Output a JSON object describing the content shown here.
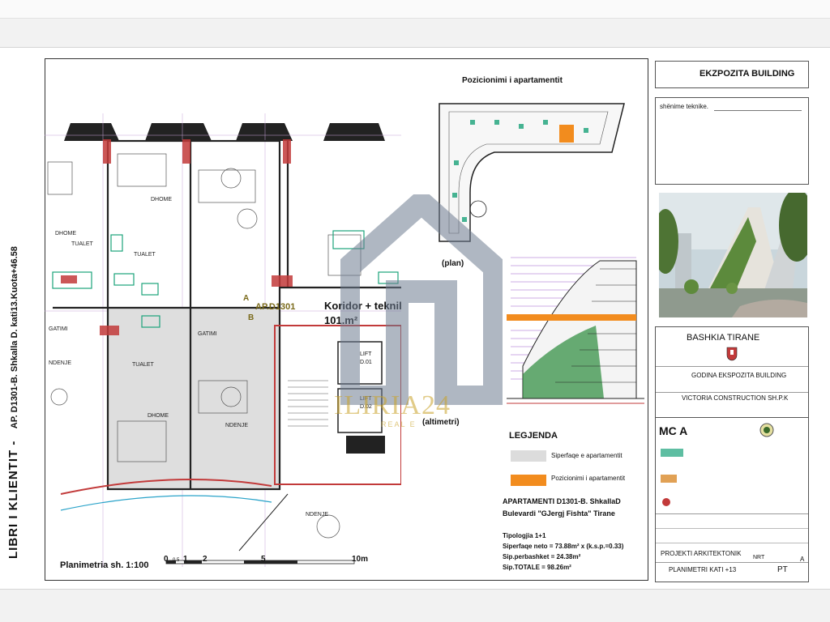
{
  "side_title": {
    "main": "LIBRI I KLIENTIT -",
    "sub": "AP. D1301-B. Shkalla D. kati13.Kuota+46.58"
  },
  "plan": {
    "apartment_label": "AP.D1301",
    "marker_a": "A",
    "marker_b": "B",
    "corridor_label": "Koridor + teknil",
    "corridor_area": "101.m²",
    "lift_1": "LIFT\nD.01",
    "lift_2": "LIFT\nD.02",
    "rooms": [
      "DHOME",
      "DHOME",
      "TUALET",
      "TUALET",
      "GATIMI",
      "GATIMI",
      "TUALET",
      "NDENJE",
      "DHOME",
      "NDENJE",
      "NDENJE"
    ],
    "scale_label": "Planimetria sh. 1:100",
    "scale_ticks": [
      "0",
      "0.5",
      "1",
      "2",
      "5",
      "10m"
    ]
  },
  "position": {
    "title": "Pozicionimi i apartamentit",
    "plan_caption": "(plan)",
    "elev_caption": "(altimetri)"
  },
  "legend": {
    "title": "LEGJENDA",
    "items": [
      {
        "label": "Siperfaqe e apartamentit",
        "color": "#dcdcdc"
      },
      {
        "label": "Pozicionimi i apartamentit",
        "color": "#f28c1e"
      }
    ]
  },
  "info": {
    "line1": "APARTAMENTI D1301-B. ShkallaD",
    "line2": "Bulevardi \"GJergj Fishta\" Tirane",
    "typology": "Tipologjia 1+1",
    "net": "Siperfaqe neto = 73.88m² x (k.s.p.=0.33)",
    "common": "Sip.perbashket = 24.38m²",
    "total": "Sip.TOTALE = 98.26m²"
  },
  "right_panel": {
    "header": "EKZPOZITA BUILDING",
    "notes_label": "shënime teknike.",
    "authority": "BASHKIA TIRANE",
    "building": "GODINA EKSPOZITA BUILDING",
    "contractor": "VICTORIA CONSTRUCTION SH.P.K",
    "project_type": "PROJEKTI ARKITEKTONIK",
    "sheet_title": "PLANIMETRI KATI +13",
    "sheet_code": "PT",
    "rev": "A",
    "nrt": "NRT",
    "mca": "MC A"
  },
  "watermark": {
    "brand": "ILIRIA24",
    "sub": "REAL E"
  },
  "colors": {
    "orange": "#f28c1e",
    "green": "#1aa37a",
    "red": "#c23a3a",
    "frame": "#333333",
    "watermark": "#6f7d92",
    "gold": "#c9a227"
  }
}
